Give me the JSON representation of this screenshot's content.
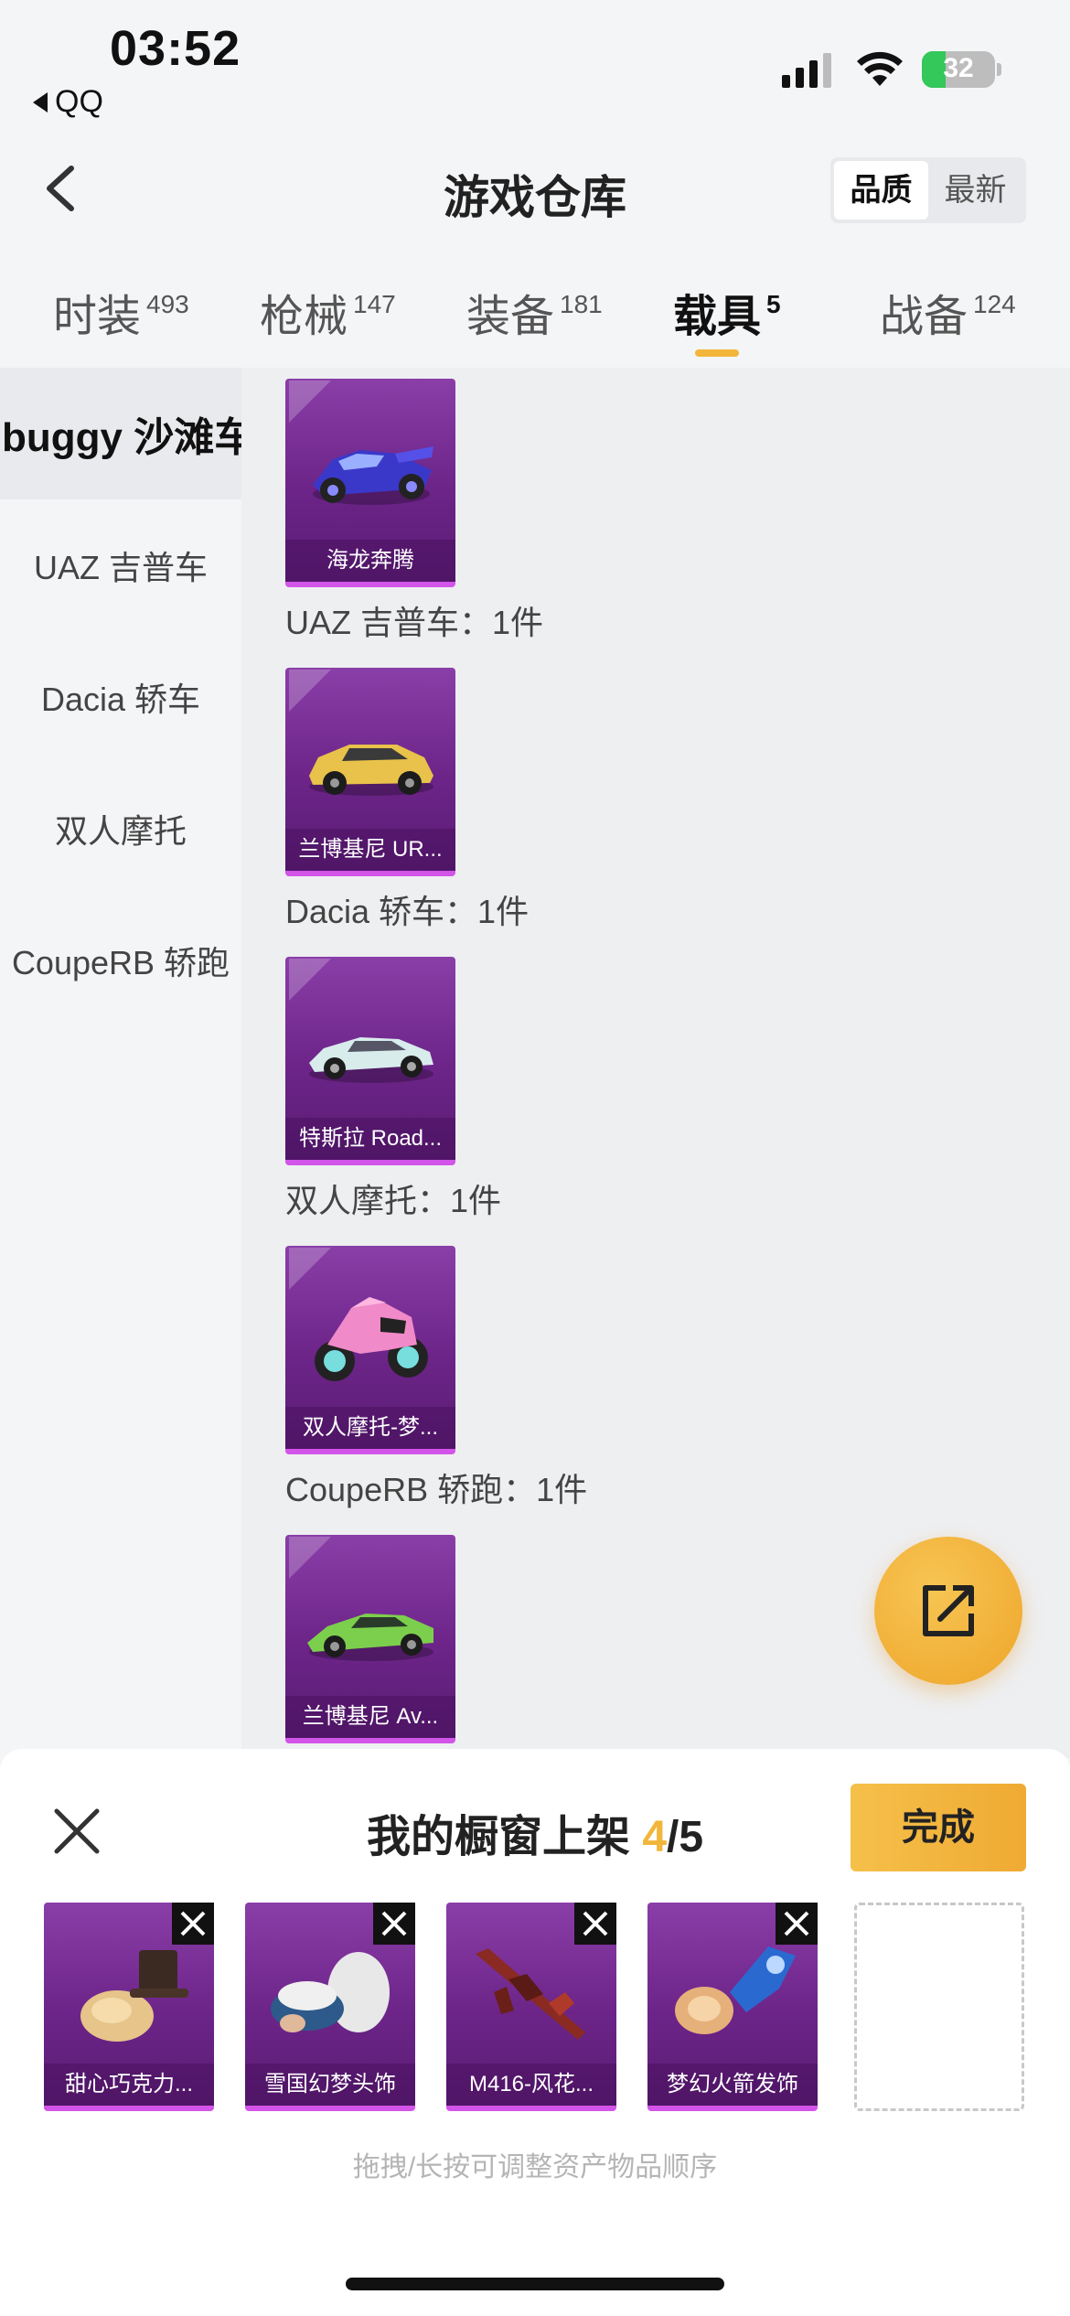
{
  "status_bar": {
    "time": "03:52",
    "back_app": "QQ",
    "battery": "32"
  },
  "header": {
    "title": "游戏仓库",
    "sort_options": [
      "品质",
      "最新"
    ],
    "sort_selected": "品质"
  },
  "tabs": [
    {
      "label": "时装",
      "count": "493"
    },
    {
      "label": "枪械",
      "count": "147"
    },
    {
      "label": "装备",
      "count": "181"
    },
    {
      "label": "载具",
      "count": "5",
      "active": true
    },
    {
      "label": "战备",
      "count": "124"
    }
  ],
  "sidebar": {
    "items": [
      {
        "label": "buggy 沙滩车",
        "active": true
      },
      {
        "label": "UAZ 吉普车"
      },
      {
        "label": "Dacia 轿车"
      },
      {
        "label": "双人摩托"
      },
      {
        "label": "CoupeRB 轿跑"
      }
    ]
  },
  "groups": [
    {
      "title": "",
      "items": [
        {
          "name": "海龙奔腾",
          "icon": "blue-racing-car"
        }
      ]
    },
    {
      "title": "UAZ 吉普车：1件",
      "items": [
        {
          "name": "兰博基尼 UR...",
          "icon": "yellow-suv"
        }
      ]
    },
    {
      "title": "Dacia 轿车：1件",
      "items": [
        {
          "name": "特斯拉 Road...",
          "icon": "white-roadster"
        }
      ]
    },
    {
      "title": "双人摩托：1件",
      "items": [
        {
          "name": "双人摩托-梦...",
          "icon": "pink-motorcycle"
        }
      ]
    },
    {
      "title": "CoupeRB 轿跑：1件",
      "items": [
        {
          "name": "兰博基尼 Av...",
          "icon": "green-supercar"
        }
      ]
    }
  ],
  "showcase": {
    "title": "我的橱窗上架",
    "current": "4",
    "total": "/5",
    "done_label": "完成",
    "slots": [
      {
        "name": "甜心巧克力...",
        "icon": "chocolate-hat"
      },
      {
        "name": "雪国幻梦头饰",
        "icon": "snow-headwear"
      },
      {
        "name": "M416-风花...",
        "icon": "m416-rifle"
      },
      {
        "name": "梦幻火箭发饰",
        "icon": "rocket-hairpin"
      }
    ],
    "hint": "拖拽/长按可调整资产物品顺序"
  },
  "colors": {
    "accent": "#f1b63a",
    "card_purple": "#6c2488",
    "card_border": "#d254e8"
  }
}
